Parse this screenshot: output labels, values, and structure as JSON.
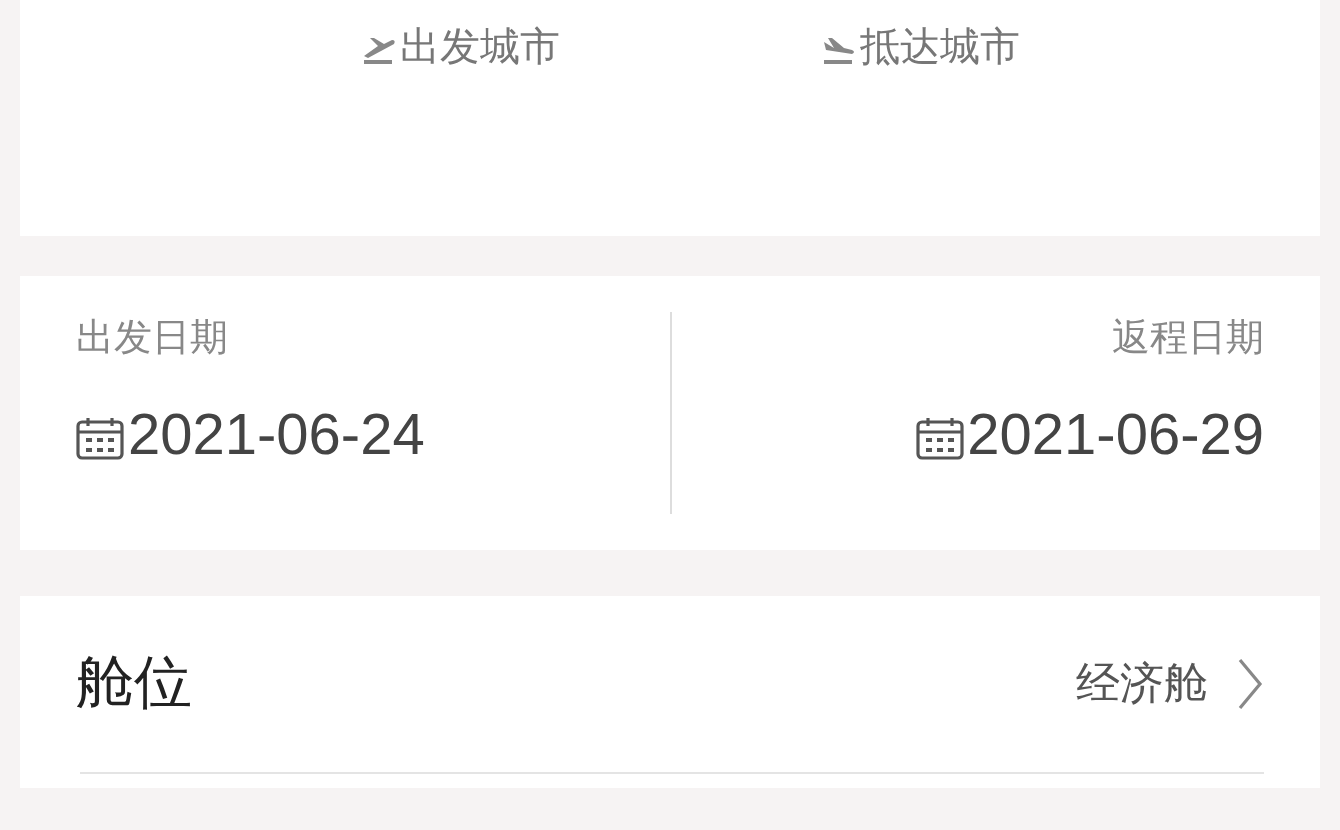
{
  "cities": [
    {
      "kind": "departure",
      "label": "出发城市"
    },
    {
      "kind": "arrival",
      "label": "抵达城市"
    }
  ],
  "dates": [
    {
      "label": "出发日期",
      "value": "2021-06-24"
    },
    {
      "label": "返程日期",
      "value": "2021-06-29"
    }
  ],
  "options": [
    {
      "label": "舱位",
      "value": "经济舱"
    }
  ]
}
